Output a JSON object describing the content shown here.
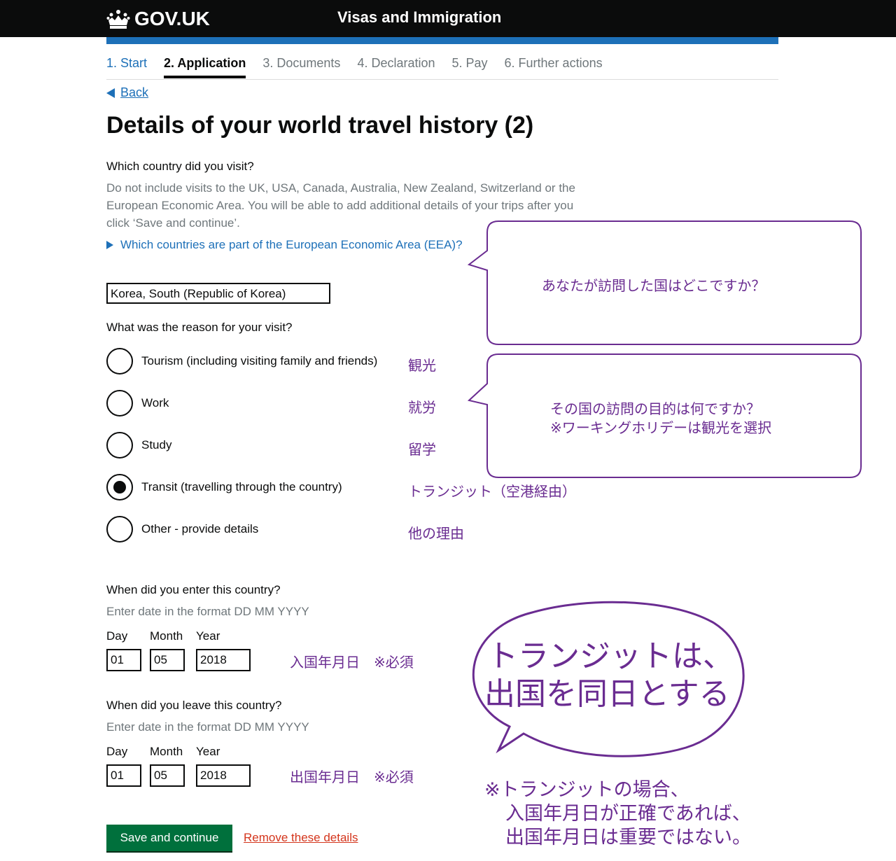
{
  "header": {
    "logo": "GOV.UK",
    "service_name": "Visas and Immigration"
  },
  "steps": [
    {
      "label": "1. Start",
      "state": "done"
    },
    {
      "label": "2. Application",
      "state": "active"
    },
    {
      "label": "3. Documents",
      "state": "todo"
    },
    {
      "label": "4. Declaration",
      "state": "todo"
    },
    {
      "label": "5. Pay",
      "state": "todo"
    },
    {
      "label": "6. Further actions",
      "state": "todo"
    }
  ],
  "back_link": "Back",
  "page_title": "Details of your world travel history (2)",
  "country_question": {
    "label": "Which country did you visit?",
    "hint": "Do not include visits to the UK, USA, Canada, Australia, New Zealand, Switzerland or the European Economic Area. You will be able to add additional details of your trips after you click ‘Save and continue’.",
    "eea_link": "Which countries are part of the European Economic Area (EEA)?",
    "value": "Korea, South (Republic of Korea)"
  },
  "reason_question": {
    "label": "What was the reason for your visit?",
    "options": [
      {
        "label": "Tourism (including visiting family and friends)",
        "note": "観光",
        "selected": false
      },
      {
        "label": "Work",
        "note": "就労",
        "selected": false
      },
      {
        "label": "Study",
        "note": "留学",
        "selected": false
      },
      {
        "label": "Transit (travelling through the country)",
        "note": "トランジット（空港経由）",
        "selected": true
      },
      {
        "label": "Other - provide details",
        "note": "他の理由",
        "selected": false
      }
    ]
  },
  "enter_date": {
    "label": "When did you enter this country?",
    "hint": "Enter date in the format DD MM YYYY",
    "day_label": "Day",
    "month_label": "Month",
    "year_label": "Year",
    "day": "01",
    "month": "05",
    "year": "2018",
    "note": "入国年月日　※必須"
  },
  "leave_date": {
    "label": "When did you leave this country?",
    "hint": "Enter date in the format DD MM YYYY",
    "day_label": "Day",
    "month_label": "Month",
    "year_label": "Year",
    "day": "01",
    "month": "05",
    "year": "2018",
    "note": "出国年月日　※必須"
  },
  "buttons": {
    "save": "Save and continue",
    "remove": "Remove these details"
  },
  "annotations": {
    "callout_country": "あなたが訪問した国はどこですか？",
    "callout_reason_line1": "その国の訪問の目的は何ですか？",
    "callout_reason_line2": "※ワーキングホリデーは観光を選択",
    "bubble_line1": "トランジットは、",
    "bubble_line2": "出国を同日とする",
    "note_line1": "※トランジットの場合、",
    "note_line2": "入国年月日が正確であれば、",
    "note_line3": "出国年月日は重要ではない。"
  },
  "colors": {
    "header_bg": "#0b0c0c",
    "accent_blue": "#1d70b8",
    "button_green": "#00703c",
    "annotation_purple": "#6a2c91"
  }
}
